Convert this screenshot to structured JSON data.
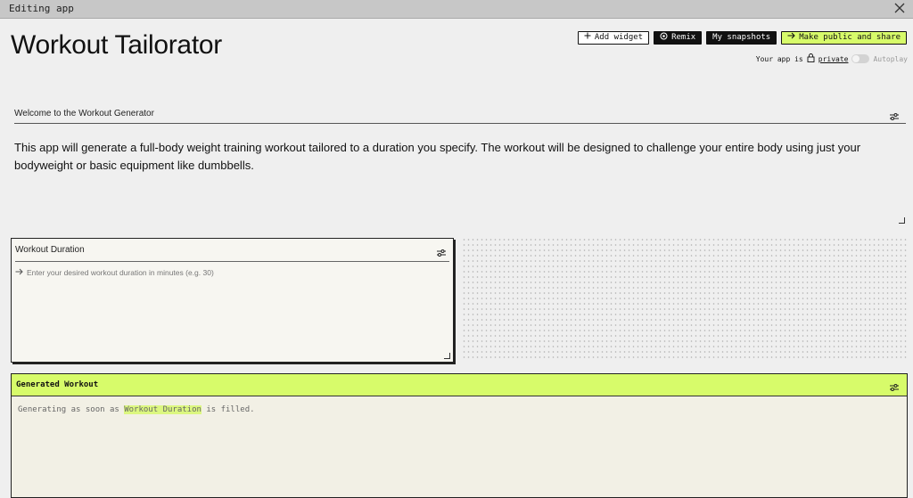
{
  "topbar": {
    "label": "Editing app"
  },
  "app": {
    "title": "Workout Tailorator"
  },
  "header_buttons": {
    "add_widget": "Add widget",
    "remix": "Remix",
    "snapshots": "My snapshots",
    "share": "Make public and share"
  },
  "visibility": {
    "prefix": "Your app is",
    "status": "private",
    "autoplay_label": "Autoplay"
  },
  "welcome": {
    "title": "Welcome to the Workout Generator",
    "body": "This app will generate a full-body weight training workout tailored to a duration you specify. The workout will be designed to challenge your entire body using just your bodyweight or basic equipment like dumbbells."
  },
  "input_widget": {
    "title": "Workout Duration",
    "placeholder": "Enter your desired workout duration in minutes (e.g. 30)"
  },
  "output_widget": {
    "title": "Generated Workout",
    "status_prefix": "Generating as soon as",
    "status_ref": "Workout Duration",
    "status_suffix": "is filled."
  },
  "colors": {
    "accent": "#d7fb6a",
    "background": "#efefef",
    "input_bg": "#f7f6f1",
    "output_bg": "#f2f0e5"
  },
  "icons": [
    "close-icon",
    "plus-icon",
    "remix-icon",
    "arrow-right-icon",
    "lock-icon",
    "settings-sliders-icon"
  ]
}
